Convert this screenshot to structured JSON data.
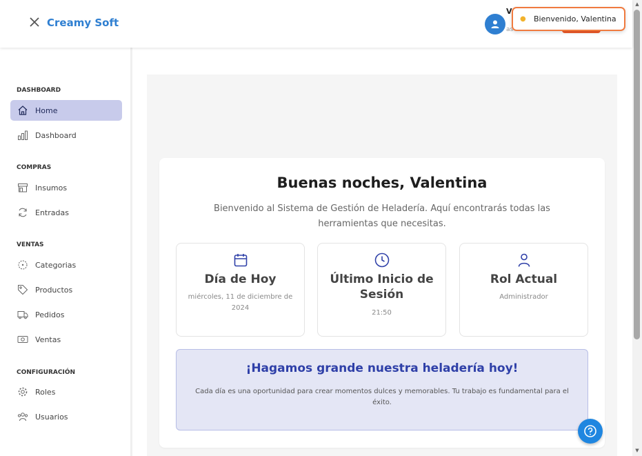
{
  "header": {
    "brand": "Creamy Soft",
    "user_initial": "V",
    "user_sub": "as",
    "toast": "Bienvenido, Valentina"
  },
  "sidebar": {
    "sections": [
      {
        "title": "DASHBOARD",
        "items": [
          {
            "label": "Home",
            "icon": "home-icon",
            "active": true
          },
          {
            "label": "Dashboard",
            "icon": "bar-chart-icon"
          }
        ]
      },
      {
        "title": "COMPRAS",
        "items": [
          {
            "label": "Insumos",
            "icon": "store-icon"
          },
          {
            "label": "Entradas",
            "icon": "refresh-icon"
          }
        ]
      },
      {
        "title": "VENTAS",
        "items": [
          {
            "label": "Categorias",
            "icon": "categories-icon"
          },
          {
            "label": "Productos",
            "icon": "tag-icon"
          },
          {
            "label": "Pedidos",
            "icon": "truck-icon"
          },
          {
            "label": "Ventas",
            "icon": "money-icon"
          }
        ]
      },
      {
        "title": "CONFIGURACIÓN",
        "items": [
          {
            "label": "Roles",
            "icon": "gear-icon"
          },
          {
            "label": "Usuarios",
            "icon": "users-icon"
          }
        ]
      }
    ]
  },
  "main": {
    "greeting": "Buenas noches, Valentina",
    "welcome": "Bienvenido al Sistema de Gestión de Heladería. Aquí encontrarás todas las herramientas que necesitas.",
    "cards": [
      {
        "title": "Día de Hoy",
        "value": "miércoles, 11 de diciembre de 2024",
        "icon": "calendar-icon"
      },
      {
        "title": "Último Inicio de Sesión",
        "value": "21:50",
        "icon": "clock-icon"
      },
      {
        "title": "Rol Actual",
        "value": "Administrador",
        "icon": "user-icon"
      }
    ],
    "banner_title": "¡Hagamos grande nuestra heladería hoy!",
    "banner_text": "Cada día es una oportunidad para crear momentos dulces y memorables. Tu trabajo es fundamental para el éxito."
  },
  "colors": {
    "accent": "#2f7fd1",
    "active_nav": "#c8cbeb",
    "banner_title": "#2f40a8",
    "toast_border": "#f07a3e"
  }
}
